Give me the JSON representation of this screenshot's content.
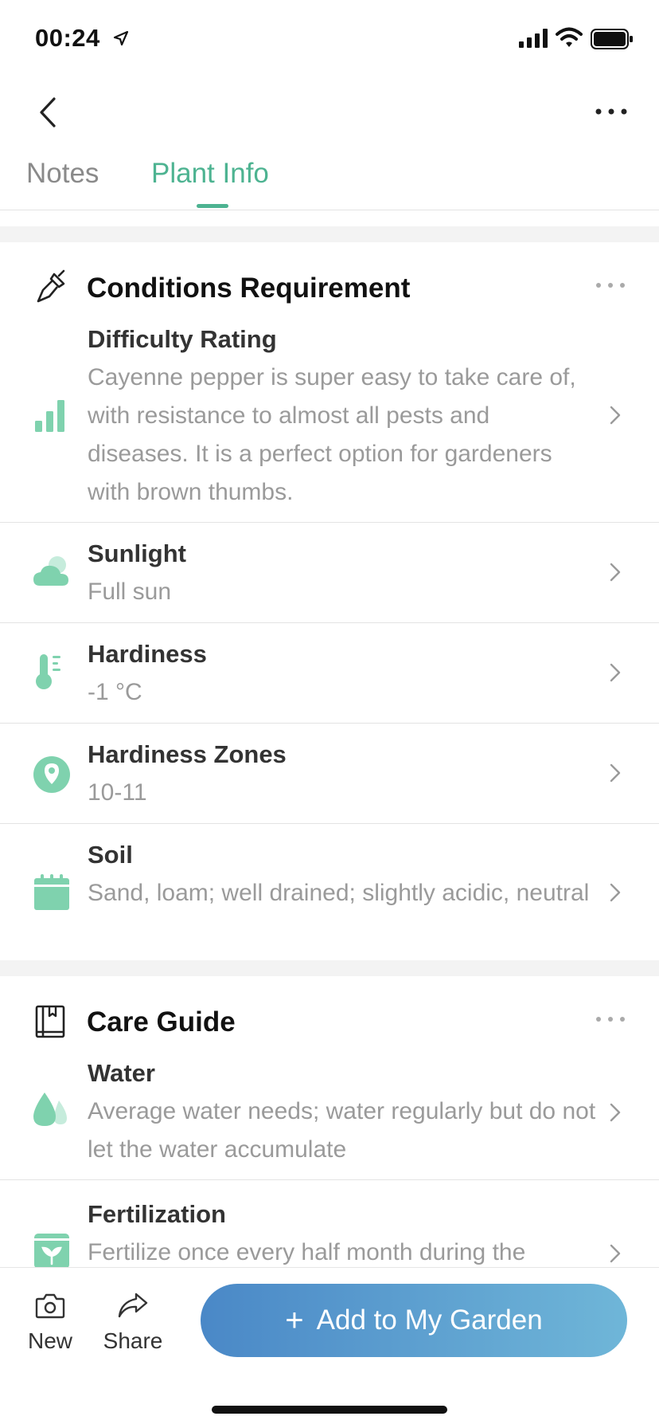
{
  "status_bar": {
    "time": "00:24"
  },
  "tabs": [
    {
      "label": "Notes",
      "active": false
    },
    {
      "label": "Plant Info",
      "active": true
    }
  ],
  "colors": {
    "accent": "#4db391",
    "icon_green": "#7fd2ae",
    "button_start": "#4a88c7",
    "button_end": "#6fb6d8"
  },
  "conditions": {
    "title": "Conditions Requirement",
    "icon": "trowel-icon",
    "items": [
      {
        "icon": "bar-chart-icon",
        "title": "Difficulty Rating",
        "desc": "Cayenne pepper is super easy to take care of, with resistance to almost all pests and diseases. It is a perfect option for gardeners with brown thumbs."
      },
      {
        "icon": "cloud-sun-icon",
        "title": "Sunlight",
        "desc": "Full sun"
      },
      {
        "icon": "thermometer-icon",
        "title": "Hardiness",
        "desc": "-1 °C"
      },
      {
        "icon": "location-pin-icon",
        "title": "Hardiness Zones",
        "desc": "10-11"
      },
      {
        "icon": "calendar-icon",
        "title": "Soil",
        "desc": "Sand, loam; well drained; slightly acidic, neutral"
      }
    ]
  },
  "care_guide": {
    "title": "Care Guide",
    "icon": "book-icon",
    "items": [
      {
        "icon": "water-drops-icon",
        "title": "Water",
        "desc": "Average water needs; water regularly but do not let the water accumulate"
      },
      {
        "icon": "fertilizer-bag-icon",
        "title": "Fertilization",
        "desc": "Fertilize once every half month during the"
      }
    ]
  },
  "bottom_bar": {
    "new_label": "New",
    "share_label": "Share",
    "add_label": "Add to My Garden"
  }
}
